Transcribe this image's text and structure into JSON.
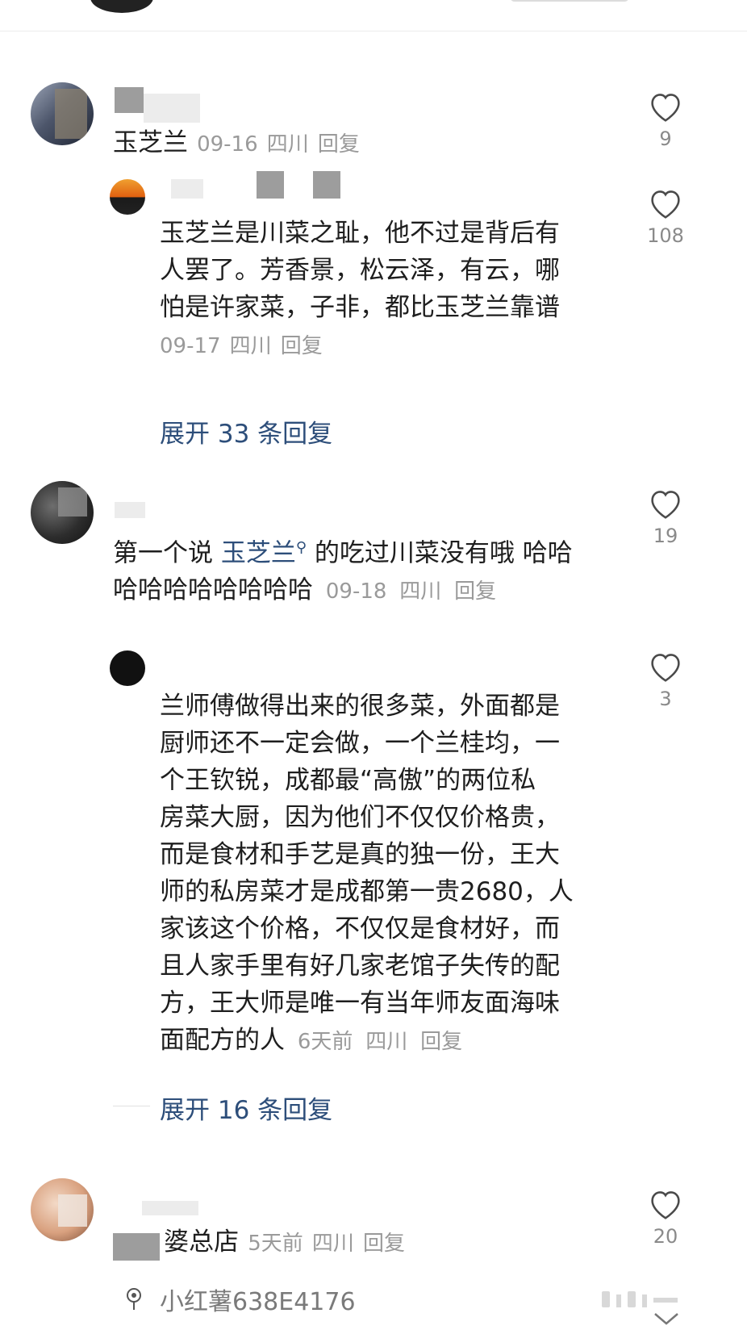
{
  "comments": [
    {
      "text": "玉芝兰",
      "date": "09-16",
      "location": "四川",
      "reply_label": "回复",
      "likes": "9"
    },
    {
      "text": "第一个说",
      "mention": "玉芝兰",
      "text_after": "的吃过川菜没有哦 哈哈",
      "text_line2": "哈哈哈哈哈哈哈哈",
      "date": "09-18",
      "location": "四川",
      "reply_label": "回复",
      "likes": "19"
    },
    {
      "text": "婆总店",
      "date": "5天前",
      "location": "四川",
      "reply_label": "回复",
      "likes": "20"
    }
  ],
  "replies": [
    {
      "lines": [
        "玉芝兰是川菜之耻，他不过是背后有",
        "人罢了。芳香景，松云泽，有云，哪",
        "怕是许家菜，子非，都比玉芝兰靠谱"
      ],
      "date": "09-17",
      "location": "四川",
      "reply_label": "回复",
      "likes": "108"
    },
    {
      "lines": [
        "兰师傅做得出来的很多菜，外面都是",
        "厨师还不一定会做，一个兰桂均，一",
        "个王钦锐，成都最“高傲”的两位私",
        "房菜大厨，因为他们不仅仅价格贵，",
        "而是食材和手艺是真的独一份，王大",
        "师的私房菜才是成都第一贵2680，人",
        "家该这个价格，不仅仅是食材好，而",
        "且人家手里有好几家老馆子失传的配",
        "方，王大师是唯一有当年师友面海味"
      ],
      "last_line": "面配方的人",
      "date": "6天前",
      "location": "四川",
      "reply_label": "回复",
      "likes": "3"
    }
  ],
  "expand": {
    "first": "展开 33 条回复",
    "second": "展开 16 条回复"
  },
  "footer": {
    "username": "小红薯638E4176"
  }
}
